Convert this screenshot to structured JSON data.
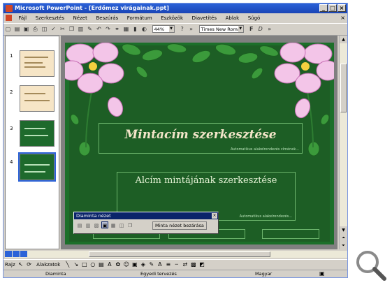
{
  "window": {
    "title": "Microsoft PowerPoint - [Erdőmez virágainak.ppt]",
    "controls": [
      "_",
      "□",
      "×"
    ]
  },
  "menu": {
    "items": [
      "Fájl",
      "Szerkesztés",
      "Nézet",
      "Beszúrás",
      "Formátum",
      "Eszközök",
      "Diavetítés",
      "Ablak",
      "Súgó"
    ],
    "close_glyph": "×"
  },
  "toolbar": {
    "zoom_value": "44%",
    "font_value": "Times New Roman"
  },
  "outline": {
    "slide_numbers": [
      "1",
      "2",
      "3",
      "4"
    ]
  },
  "slide": {
    "title": "Mintacím szerkesztése",
    "title_auto_label": "Automatikus alakelrendezés címének...",
    "subtitle": "Alcím mintájának szerkesztése",
    "subtitle_auto_label": "Automatikus alakelrendezés...",
    "colors": {
      "background": "#1d5e25",
      "border_green": "#6cb56c",
      "title_text": "#f3e5c9"
    }
  },
  "floating_toolbar": {
    "title": "Diaminta nézet",
    "close_glyph": "×",
    "button_label": "Minta nézet bezárása"
  },
  "drawing_toolbar": {
    "draw_label": "Rajz",
    "autoshapes_label": "Alakzatok"
  },
  "status_bar": {
    "view_label": "Diaminta",
    "design_label": "Egyedi tervezés",
    "language_label": "Magyar"
  }
}
